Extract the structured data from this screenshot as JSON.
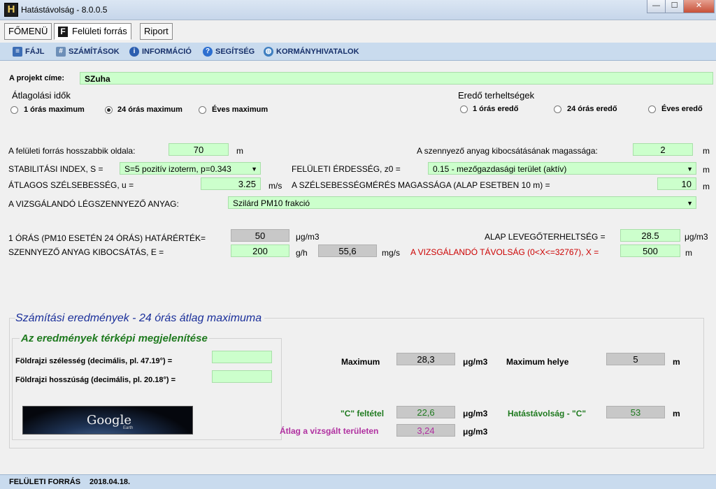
{
  "window": {
    "title": "Hatástávolság - 8.0.0.5",
    "icon_letter": "H",
    "min": "—",
    "max": "☐",
    "close": "✕"
  },
  "tabs": [
    {
      "label": "FŐMENÜ"
    },
    {
      "label": "Felületi forrás",
      "icon_letter": "F",
      "active": true
    },
    {
      "label": "Riport"
    }
  ],
  "menu": [
    {
      "label": "FÁJL",
      "icon": "file-icon"
    },
    {
      "label": "SZÁMÍTÁSOK",
      "icon": "calculator-icon"
    },
    {
      "label": "INFORMÁCIÓ",
      "icon": "info-icon"
    },
    {
      "label": "SEGÍTSÉG",
      "icon": "help-icon"
    },
    {
      "label": "KORMÁNYHIVATALOK",
      "icon": "globe-icon"
    }
  ],
  "project": {
    "label": "A projekt címe:",
    "value": "SZuha"
  },
  "averaging": {
    "title": "Átlagolási idők",
    "options": [
      "1 órás maximum",
      "24 órás maximum",
      "Éves maximum"
    ],
    "selected": "24 órás maximum"
  },
  "loads": {
    "title": "Eredő terheltségek",
    "options": [
      "1 órás eredő",
      "24 órás eredő",
      "Éves eredő"
    ]
  },
  "params": {
    "longest_side_label": "A felületi forrás hosszabbik oldala:",
    "longest_side_value": "70",
    "longest_side_unit": "m",
    "emission_height_label": "A szennyező anyag kibocsátásának magassága:",
    "emission_height_value": "2",
    "emission_height_unit": "m",
    "stability_label": "STABILITÁSI INDEX, S =",
    "stability_value": "S=5 pozitív izoterm, p=0.343",
    "roughness_label": "FELÜLETI ÉRDESSÉG, z0 =",
    "roughness_value": "0.15 - mezőgazdasági terület (aktív)",
    "roughness_unit": "m",
    "wind_label": "ÁTLAGOS SZÉLSEBESSÉG, u =",
    "wind_value": "3.25",
    "wind_unit": "m/s",
    "wind_height_label": "A SZÉLSEBESSÉGMÉRÉS MAGASSÁGA (ALAP ESETBEN 10 m) =",
    "wind_height_value": "10",
    "wind_height_unit": "m",
    "pollutant_label": "A VIZSGÁLANDÓ LÉGSZENNYEZŐ ANYAG:",
    "pollutant_value": "Szilárd PM10 frakció",
    "limit_label": "1 ÓRÁS  (PM10 ESETÉN 24 ÓRÁS) HATÁRÉRTÉK=",
    "limit_value": "50",
    "limit_unit": "μg/m3",
    "background_label": "ALAP LEVEGŐTERHELTSÉG =",
    "background_value": "28.5",
    "background_unit": "μg/m3",
    "emission_label": "SZENNYEZŐ ANYAG KIBOCSÁTÁS, E =",
    "emission_value": "200",
    "emission_unit": "g/h",
    "emission_ms_value": "55,6",
    "emission_ms_unit": "mg/s",
    "distance_label": "A VIZSGÁLANDÓ TÁVOLSÁG (0<X<=32767), X =",
    "distance_value": "500",
    "distance_unit": "m"
  },
  "results": {
    "title": "Számítási eredmények - 24 órás átlag maximuma",
    "map_title": "Az eredmények térképi megjelenítése",
    "lat_label": "Földrajzi szélesség (decimális, pl. 47.19°) =",
    "lat_value": "",
    "lon_label": "Földrajzi hosszúság (decimális, pl. 20.18°) =",
    "lon_value": "",
    "google_label": "Google",
    "google_sub": "Earth",
    "max_label": "Maximum",
    "max_value": "28,3",
    "max_unit": "μg/m3",
    "max_loc_label": "Maximum helye",
    "max_loc_value": "5",
    "max_loc_unit": "m",
    "c_label": "\"C\" feltétel",
    "c_value": "22,6",
    "c_unit": "μg/m3",
    "c_dist_label": "Hatástávolság - \"C\"",
    "c_dist_value": "53",
    "c_dist_unit": "m",
    "avg_label": "Átlag a vizsgált területen",
    "avg_value": "3,24",
    "avg_unit": "μg/m3"
  },
  "status": {
    "left": "FELÜLETI FORRÁS",
    "date": "2018.04.18."
  },
  "colors": {
    "field": "#ccffcc",
    "result_blue": "#1a2f9a",
    "map_green": "#1f7a1f",
    "red": "#cc0000",
    "purple": "#b030a0"
  }
}
